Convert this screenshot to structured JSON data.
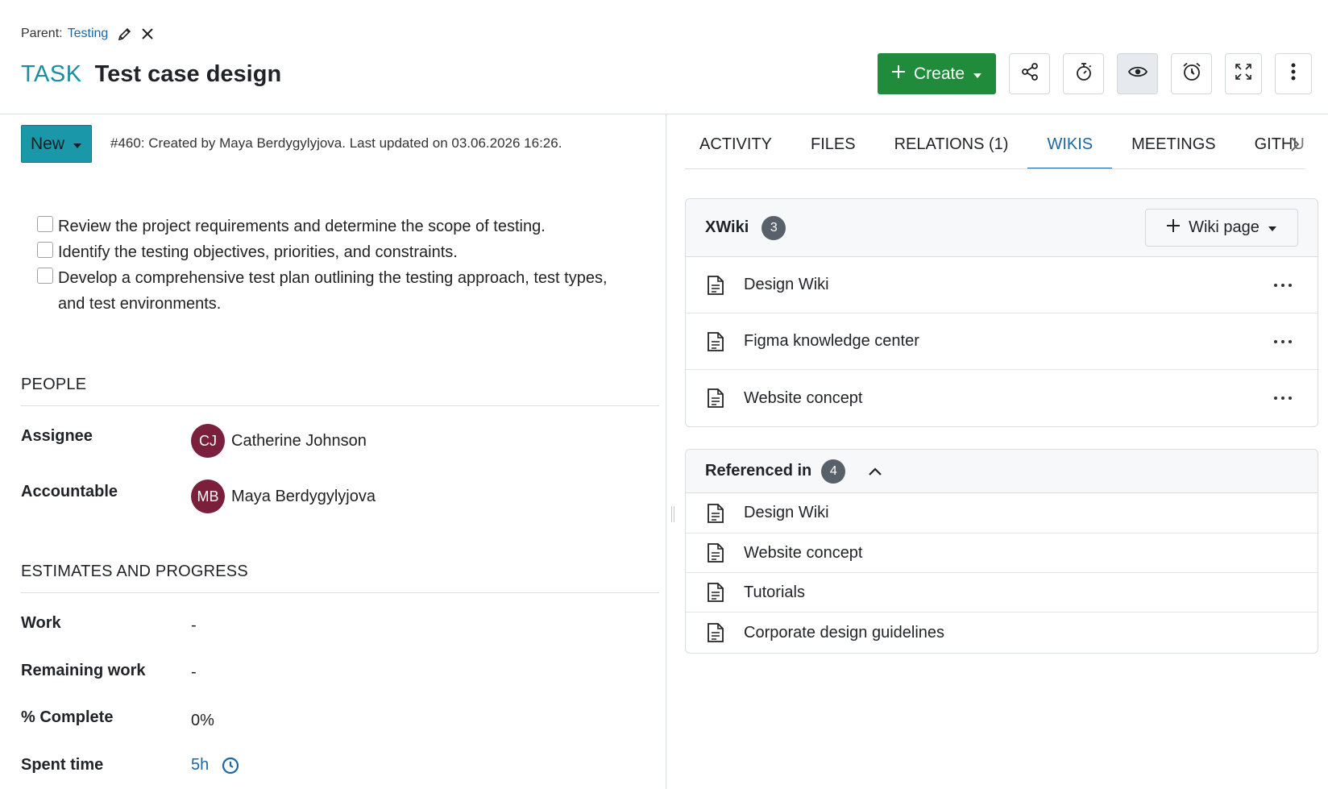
{
  "header": {
    "parent_label": "Parent:",
    "parent_link": "Testing",
    "type": "TASK",
    "subject": "Test case design"
  },
  "toolbar": {
    "create_label": "Create",
    "icons": [
      "share-icon",
      "stopwatch-icon",
      "eye-icon",
      "alarm-icon",
      "fullscreen-icon",
      "more-vertical-icon"
    ]
  },
  "status": {
    "label": "New",
    "meta": "#460: Created by Maya Berdygylyjova. Last updated on 03.06.2026 16:26."
  },
  "checklist": [
    {
      "text": "Review the project requirements and determine the scope of testing.",
      "checked": false
    },
    {
      "text": "Identify the testing objectives, priorities, and constraints.",
      "checked": false
    },
    {
      "text": "Develop a comprehensive test plan outlining the testing approach, test types, and test environments.",
      "checked": false
    }
  ],
  "people": {
    "title": "PEOPLE",
    "assignee_label": "Assignee",
    "assignee_initials": "CJ",
    "assignee_name": "Catherine Johnson",
    "accountable_label": "Accountable",
    "accountable_initials": "MB",
    "accountable_name": "Maya Berdygylyjova"
  },
  "estimates": {
    "title": "ESTIMATES AND PROGRESS",
    "work_label": "Work",
    "work_value": "-",
    "remaining_label": "Remaining work",
    "remaining_value": "-",
    "complete_label": "% Complete",
    "complete_value": "0%",
    "spent_label": "Spent time",
    "spent_value": "5h"
  },
  "tabs": [
    {
      "label": "ACTIVITY",
      "active": false
    },
    {
      "label": "FILES",
      "active": false
    },
    {
      "label": "RELATIONS (1)",
      "active": false
    },
    {
      "label": "WIKIS",
      "active": true
    },
    {
      "label": "MEETINGS",
      "active": false
    },
    {
      "label": "GITHU",
      "active": false
    }
  ],
  "xwiki": {
    "title": "XWiki",
    "count": "3",
    "add_label": "Wiki page",
    "pages": [
      "Design Wiki",
      "Figma knowledge center",
      "Website concept"
    ]
  },
  "referenced": {
    "title": "Referenced in",
    "count": "4",
    "pages": [
      "Design Wiki",
      "Website concept",
      "Tutorials",
      "Corporate design guidelines"
    ]
  },
  "colors": {
    "accent": "#1a67a3",
    "type": "#1a8fa0",
    "create": "#208b3a",
    "status": "#1a97a8",
    "avatar": "#7a1f3c"
  }
}
